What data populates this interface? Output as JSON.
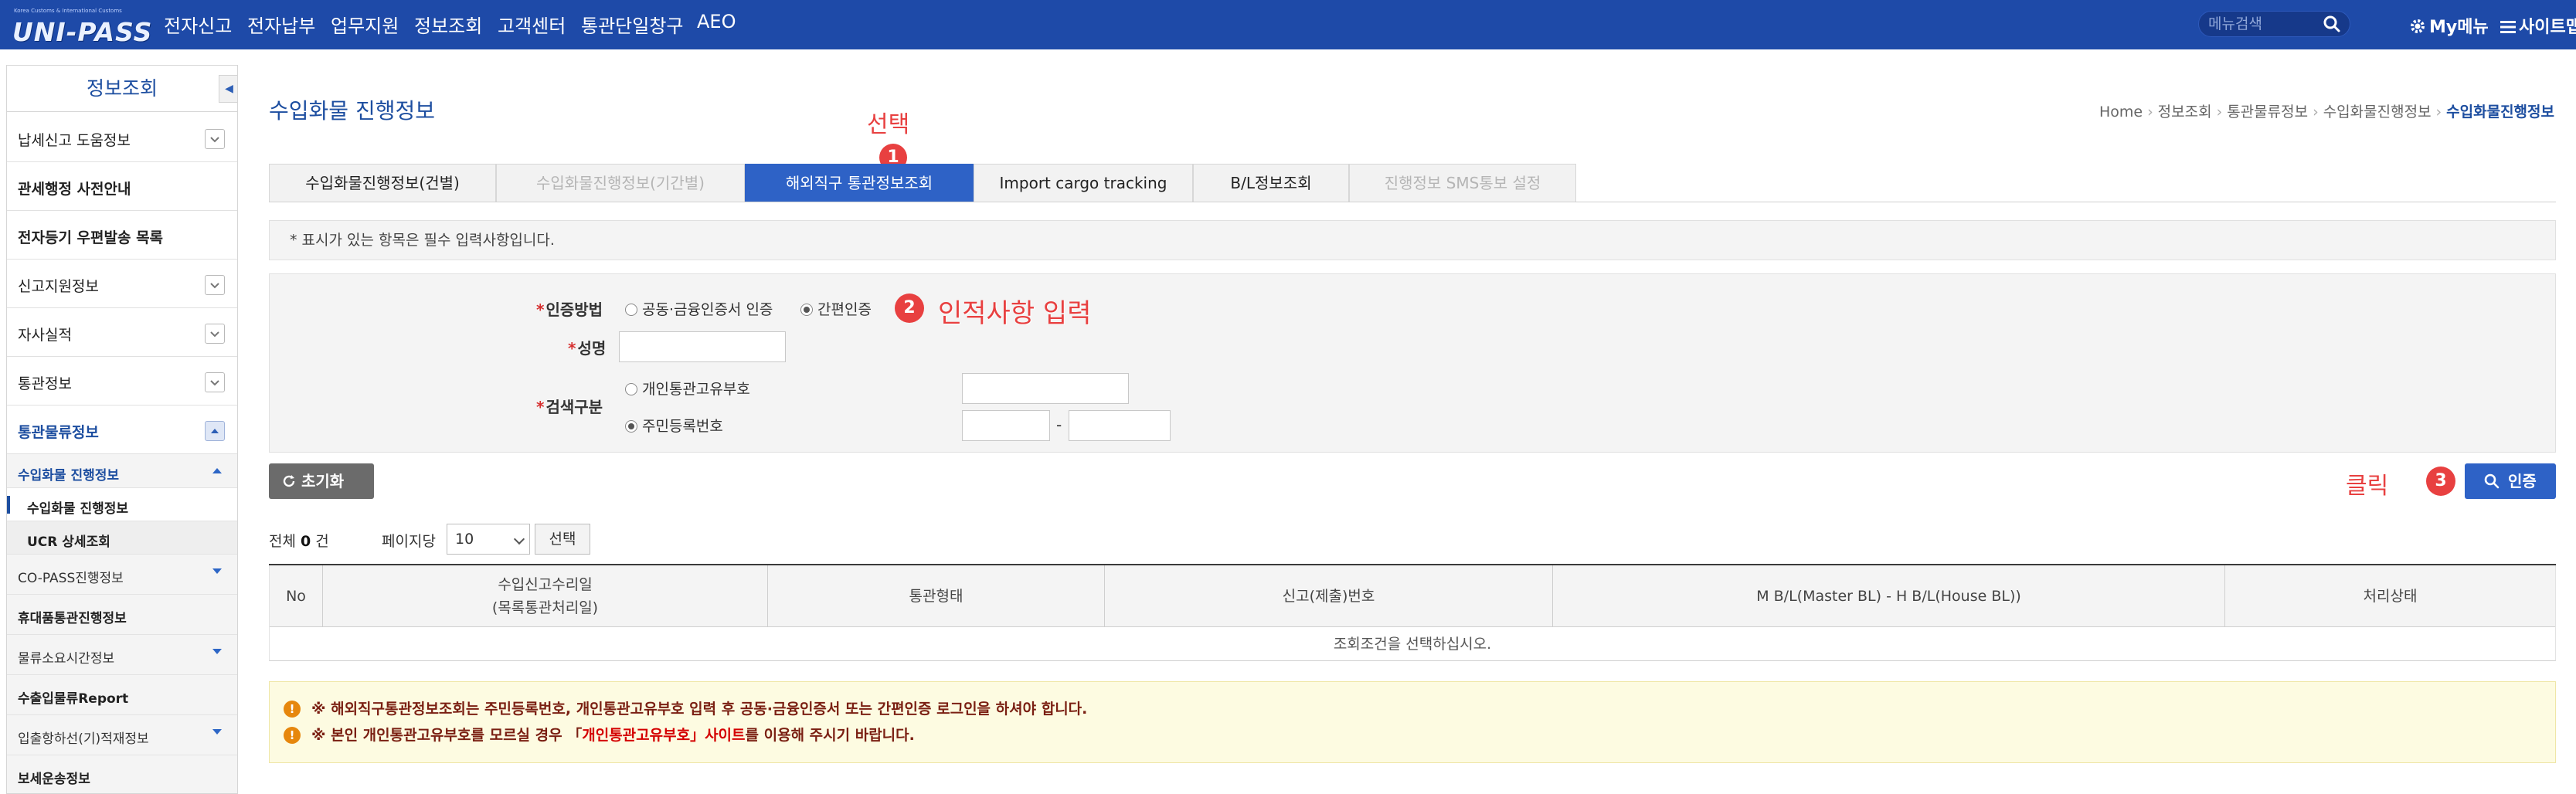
{
  "topbar": {
    "logo_tagline": "Korea Customs & International Customs",
    "logo_text": "UNI-PASS",
    "nav": [
      "전자신고",
      "전자납부",
      "업무지원",
      "정보조회",
      "고객센터",
      "통관단일창구",
      "AEO"
    ],
    "search_placeholder": "메뉴검색",
    "my_menu": "My메뉴",
    "sitemap": "사이트맵"
  },
  "sidebar": {
    "title": "정보조회",
    "items": [
      {
        "label": "납세신고 도움정보"
      },
      {
        "label": "관세행정 사전안내"
      },
      {
        "label": "전자등기 우편발송 목록"
      },
      {
        "label": "신고지원정보"
      },
      {
        "label": "자사실적"
      },
      {
        "label": "통관정보"
      },
      {
        "label": "통관물류정보"
      }
    ],
    "subitems": [
      {
        "label": "수입화물 진행정보"
      },
      {
        "label": "수입화물 진행정보"
      },
      {
        "label": "UCR 상세조회"
      },
      {
        "label": "CO-PASS진행정보"
      },
      {
        "label": "휴대품통관진행정보"
      },
      {
        "label": "물류소요시간정보"
      },
      {
        "label": "수출입물류Report"
      },
      {
        "label": "입출항하선(기)적재정보"
      },
      {
        "label": "보세운송정보"
      }
    ]
  },
  "main": {
    "page_title": "수입화물 진행정보",
    "breadcrumb": [
      "Home",
      "정보조회",
      "통관물류정보",
      "수입화물진행정보",
      "수입화물진행정보"
    ],
    "tabs": [
      {
        "label": "수입화물진행정보(건별)",
        "state": "normal"
      },
      {
        "label": "수입화물진행정보(기간별)",
        "state": "disabled"
      },
      {
        "label": "해외직구 통관정보조회",
        "state": "active"
      },
      {
        "label": "Import cargo tracking",
        "state": "normal"
      },
      {
        "label": "B/L정보조회",
        "state": "normal"
      },
      {
        "label": "진행정보 SMS통보 설정",
        "state": "disabled"
      }
    ],
    "notice": "* 표시가 있는 항목은 필수 입력사항입니다.",
    "form": {
      "auth_method_label": "인증방법",
      "auth_options": [
        "공동·금융인증서 인증",
        "간편인증"
      ],
      "auth_selected": "간편인증",
      "name_label": "성명",
      "search_type_label": "검색구분",
      "search_options": [
        "개인통관고유부호",
        "주민등록번호"
      ],
      "search_selected": "주민등록번호",
      "dash": "-"
    },
    "reset_button": "초기화",
    "auth_button": "인증",
    "total_prefix": "전체",
    "total_count": "0",
    "total_suffix": "건",
    "per_page_label": "페이지당",
    "per_page_value": "10",
    "select_button": "선택",
    "table": {
      "columns": [
        "No",
        "수입신고수리일\n(목록통관처리일)",
        "통관형태",
        "신고(제출)번호",
        "M B/L(Master BL) - H B/L(House BL))",
        "처리상태"
      ],
      "empty_message": "조회조건을 선택하십시오."
    },
    "warnings": [
      {
        "prefix": "※ 해외직구통관정보조회는 주민등록번호, 개인통관고유부호 입력 후 공동·금융인증서 또는 간편인증 로그인을 하셔야 합니다.",
        "link": "",
        "suffix": ""
      },
      {
        "prefix": "※ 본인 개인통관고유부호를 모르실 경우 「",
        "link": "개인통관고유부호」사이트",
        "suffix": "를 이용해 주시기 바랍니다."
      }
    ]
  },
  "annotations": {
    "step1_label": "선택",
    "step1_num": "1",
    "step2_label": "인적사항 입력",
    "step2_num": "2",
    "step3_label": "클릭",
    "step3_num": "3"
  },
  "colors": {
    "topbar": "#1e4aa8",
    "accent": "#2e62c6",
    "annotation": "#e84040"
  }
}
